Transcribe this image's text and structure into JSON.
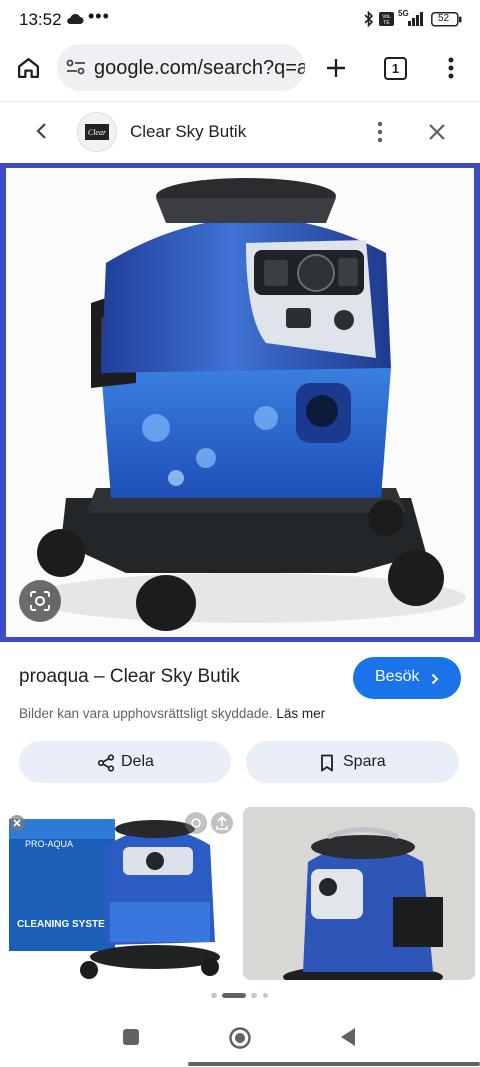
{
  "status_bar": {
    "time": "13:52",
    "more": "•••",
    "battery": "52",
    "network": "5G"
  },
  "browser": {
    "url": "google.com/search?q=a",
    "tab_count": "1",
    "icons": [
      "home-icon",
      "site-info-icon",
      "new-tab-icon",
      "tab-switcher-icon",
      "menu-icon"
    ]
  },
  "viewer": {
    "site_name": "Clear Sky Butik",
    "logo_text": "Clear",
    "title": "proaqua – Clear Sky Butik",
    "visit_label": "Besök",
    "copyright": "Bilder kan vara upphovsrättsligt skyddade.",
    "learn_more": "Läs mer",
    "share_label": "Dela",
    "save_label": "Spara",
    "thumb1_box_brand": "PRO-AQUA",
    "thumb1_box_text": "CLEANING SYSTEM",
    "accent_color": "#1a73e8",
    "image_border_color": "#3c4cc6"
  }
}
